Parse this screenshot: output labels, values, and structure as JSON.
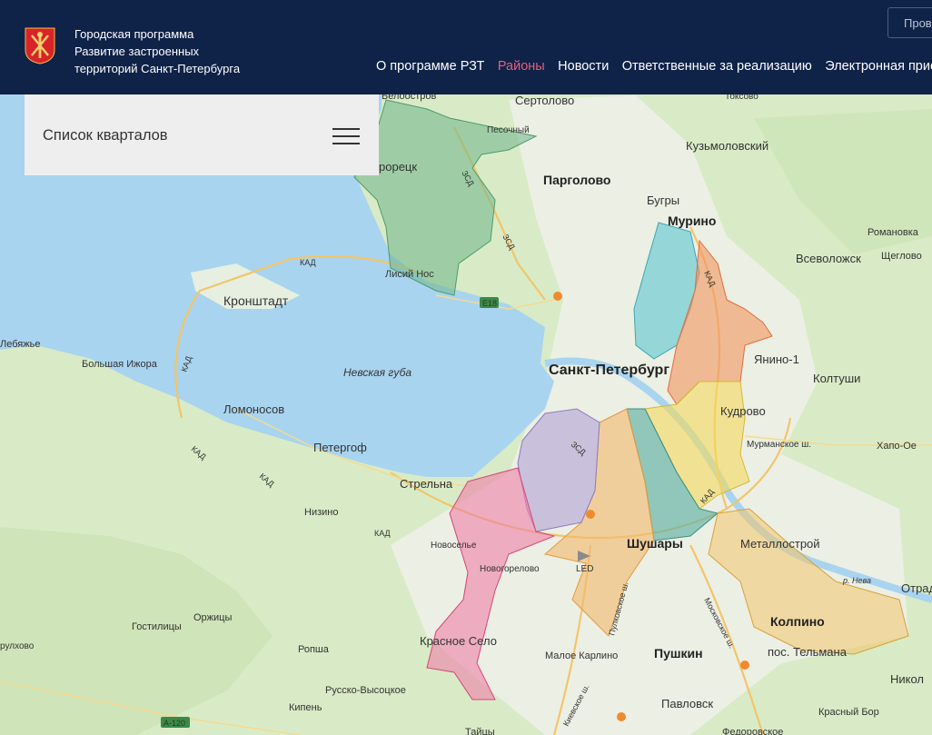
{
  "header": {
    "logo_icon": "coat-of-arms-icon",
    "title_lines": [
      "Городская программа",
      "Развитие застроенных",
      "территорий Санкт-Петербурга"
    ],
    "nav": [
      {
        "label": "О программе РЗТ",
        "active": false
      },
      {
        "label": "Районы",
        "active": true
      },
      {
        "label": "Новости",
        "active": false
      },
      {
        "label": "Ответственные за реализацию",
        "active": false
      },
      {
        "label": "Электронная прие",
        "active": false
      }
    ],
    "top_button": "Пров"
  },
  "panel": {
    "title": "Список кварталов",
    "menu_icon": "hamburger-menu-icon"
  },
  "map": {
    "water_label": "Невская губа",
    "places": [
      {
        "name": "Белоостров"
      },
      {
        "name": "Сертолово"
      },
      {
        "name": "Песочный"
      },
      {
        "name": "Токсово"
      },
      {
        "name": "Кузьмоловский"
      },
      {
        "name": "рорецк"
      },
      {
        "name": "Парголово"
      },
      {
        "name": "Бугры"
      },
      {
        "name": "Мурино"
      },
      {
        "name": "Романовка"
      },
      {
        "name": "Всеволожск"
      },
      {
        "name": "Щеглово"
      },
      {
        "name": "Лисий Нос"
      },
      {
        "name": "Кронштадт"
      },
      {
        "name": "Лебяжье"
      },
      {
        "name": "Большая Ижора"
      },
      {
        "name": "Санкт-Петербург"
      },
      {
        "name": "Янино-1"
      },
      {
        "name": "Колтуши"
      },
      {
        "name": "Ломоносов"
      },
      {
        "name": "Кудрово"
      },
      {
        "name": "Мурманское ш."
      },
      {
        "name": "Хапо-Ое"
      },
      {
        "name": "Петергоф"
      },
      {
        "name": "Стрельна"
      },
      {
        "name": "Низино"
      },
      {
        "name": "Металлострой"
      },
      {
        "name": "Шушары"
      },
      {
        "name": "Новоселье"
      },
      {
        "name": "Новогорелово"
      },
      {
        "name": "LED"
      },
      {
        "name": "Отрад"
      },
      {
        "name": "Колпино"
      },
      {
        "name": "пос. Тельмана"
      },
      {
        "name": "Гостилицы"
      },
      {
        "name": "Оржицы"
      },
      {
        "name": "Ропша"
      },
      {
        "name": "Красное Село"
      },
      {
        "name": "Малое Карлино"
      },
      {
        "name": "Пушкин"
      },
      {
        "name": "Никол"
      },
      {
        "name": "Русско-Высоцкое"
      },
      {
        "name": "Кипень"
      },
      {
        "name": "Павловск"
      },
      {
        "name": "Красный Бор"
      },
      {
        "name": "Тайцы"
      },
      {
        "name": "Федоровское"
      },
      {
        "name": "рулхово"
      }
    ],
    "road_labels": {
      "kad": "КАД",
      "zsd": "ЗСД",
      "e18": "Е18",
      "a120": "А-120",
      "moskovskoe": "Московское ш.",
      "pulkovskoe": "Пулковское ш.",
      "kievskoe": "Киевское ш.",
      "neva": "р. Нева"
    },
    "district_colors": [
      "#6fb58a",
      "#5cc4d0",
      "#f2955f",
      "#f4d85c",
      "#5fb0a3",
      "#f3b86b",
      "#b7a7d6",
      "#ef7fa6"
    ]
  }
}
